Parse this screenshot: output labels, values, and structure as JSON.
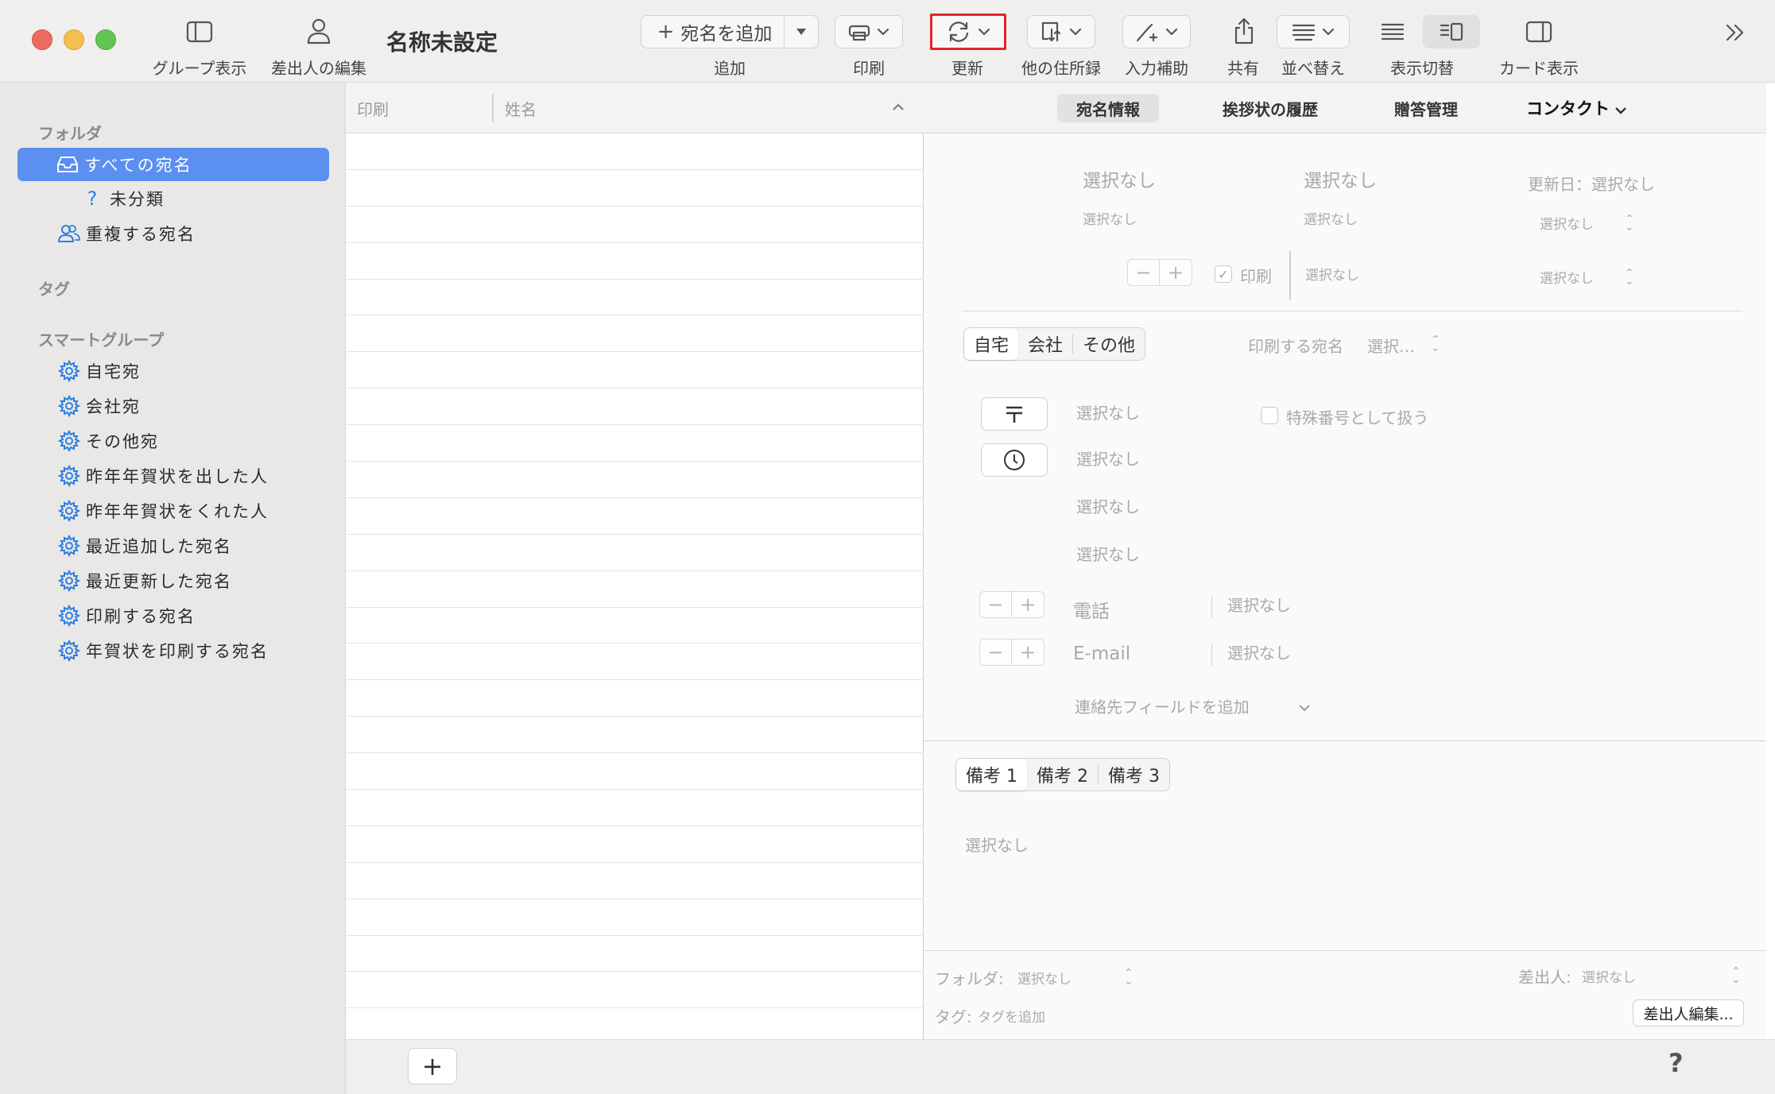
{
  "window": {
    "title": "名称未設定"
  },
  "toolbar": {
    "group_view": "グループ表示",
    "sender_edit": "差出人の編集",
    "add_address_button": "宛名を追加",
    "add_label": "追加",
    "print_label": "印刷",
    "update_label": "更新",
    "other_address_book_label": "他の住所録",
    "input_assist_label": "入力補助",
    "share_label": "共有",
    "sort_label": "並べ替え",
    "display_switch_label": "表示切替",
    "card_view_label": "カード表示",
    "highlight_color": "#e0262a"
  },
  "sidebar": {
    "folder_section": "フォルダ",
    "items": [
      {
        "label": "すべての宛名",
        "icon": "tray-icon",
        "selected": true
      },
      {
        "label": "未分類",
        "icon": "question-icon"
      },
      {
        "label": "重複する宛名",
        "icon": "people-icon"
      }
    ],
    "tag_section": "タグ",
    "smart_section": "スマートグループ",
    "smart_groups": [
      {
        "label": "自宅宛"
      },
      {
        "label": "会社宛"
      },
      {
        "label": "その他宛"
      },
      {
        "label": "昨年年賀状を出した人"
      },
      {
        "label": "昨年年賀状をくれた人"
      },
      {
        "label": "最近追加した宛名"
      },
      {
        "label": "最近更新した宛名"
      },
      {
        "label": "印刷する宛名"
      },
      {
        "label": "年賀状を印刷する宛名"
      }
    ],
    "accent_color": "#5b8ff0"
  },
  "list": {
    "columns": [
      "印刷",
      "姓名"
    ]
  },
  "detail": {
    "tabs": [
      "宛名情報",
      "挨拶状の履歴",
      "贈答管理",
      "コンタクト"
    ],
    "active_tab": "宛名情報",
    "name_last": "選択なし",
    "name_first": "選択なし",
    "kana_last": "選択なし",
    "kana_first": "選択なし",
    "updated": "更新日：選択なし",
    "select_1": "選択なし",
    "select_2": "選択なし",
    "honorific": "選択なし",
    "print_checkbox": "印刷",
    "address_tabs": [
      "自宅",
      "会社",
      "その他"
    ],
    "print_address_label": "印刷する宛名",
    "print_address_value": "選択…",
    "postal_value": "選択なし",
    "special_number": "特殊番号として扱う",
    "address_1": "選択なし",
    "address_2": "選択なし",
    "address_3": "選択なし",
    "phone_label": "電話",
    "phone_value": "選択なし",
    "email_label": "E-mail",
    "email_value": "選択なし",
    "add_contact_field": "連絡先フィールドを追加",
    "note_tabs": [
      "備考 1",
      "備考 2",
      "備考 3"
    ],
    "note_value": "選択なし",
    "folder_label": "フォルダ:",
    "folder_value": "選択なし",
    "sender_label": "差出人:",
    "sender_value": "選択なし",
    "tag_label": "タグ:",
    "tag_value": "タグを追加",
    "sender_edit_button": "差出人編集..."
  },
  "footer": {
    "add_symbol": "+",
    "help_symbol": "?"
  }
}
